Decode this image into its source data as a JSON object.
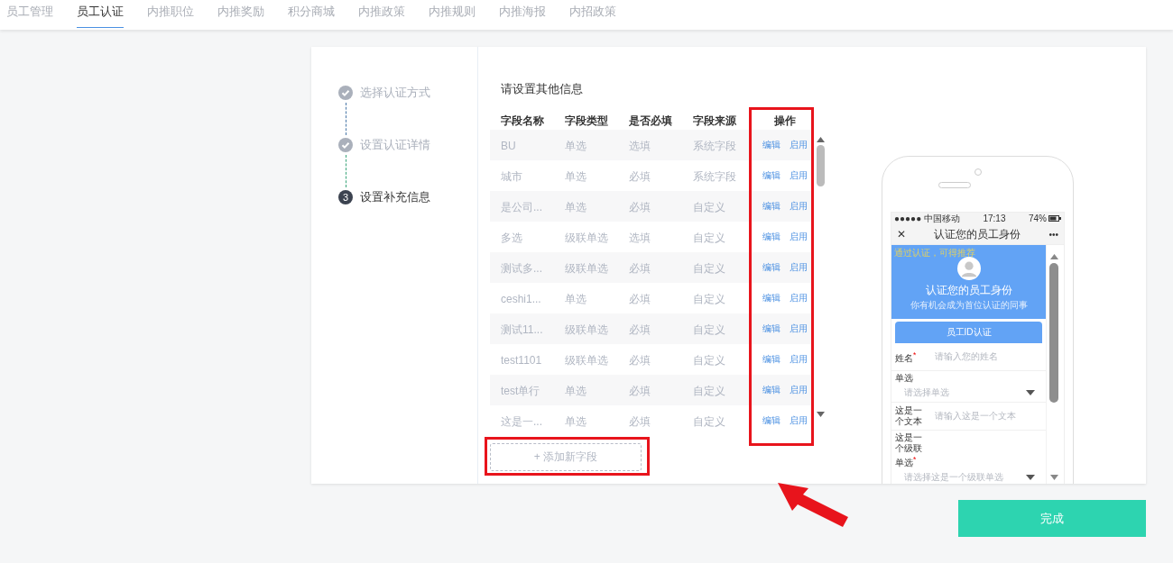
{
  "nav_tabs": [
    {
      "label": "员工管理",
      "selected": false
    },
    {
      "label": "员工认证",
      "selected": true
    },
    {
      "label": "内推职位",
      "selected": false
    },
    {
      "label": "内推奖励",
      "selected": false
    },
    {
      "label": "积分商城",
      "selected": false
    },
    {
      "label": "内推政策",
      "selected": false
    },
    {
      "label": "内推规则",
      "selected": false
    },
    {
      "label": "内推海报",
      "selected": false
    },
    {
      "label": "内招政策",
      "selected": false
    }
  ],
  "steps": [
    {
      "label": "选择认证方式",
      "kind": "done"
    },
    {
      "label": "设置认证详情",
      "kind": "done"
    },
    {
      "label": "设置补充信息",
      "kind": "current",
      "number": "3"
    }
  ],
  "section_title": "请设置其他信息",
  "table": {
    "columns": [
      "字段名称",
      "字段类型",
      "是否必填",
      "字段来源",
      "操作"
    ],
    "rows": [
      {
        "cells": [
          "BU",
          "单选",
          "选填",
          "系统字段"
        ],
        "actions": [
          "编辑",
          "启用"
        ]
      },
      {
        "cells": [
          "城市",
          "单选",
          "必填",
          "系统字段"
        ],
        "actions": [
          "编辑",
          "启用"
        ]
      },
      {
        "cells": [
          "是公司...",
          "单选",
          "必填",
          "自定义"
        ],
        "actions": [
          "编辑",
          "启用"
        ]
      },
      {
        "cells": [
          "多选",
          "级联单选",
          "选填",
          "自定义"
        ],
        "actions": [
          "编辑",
          "启用"
        ]
      },
      {
        "cells": [
          "测试多...",
          "级联单选",
          "必填",
          "自定义"
        ],
        "actions": [
          "编辑",
          "启用"
        ]
      },
      {
        "cells": [
          "ceshi1...",
          "单选",
          "必填",
          "自定义"
        ],
        "actions": [
          "编辑",
          "启用"
        ]
      },
      {
        "cells": [
          "测试11...",
          "级联单选",
          "必填",
          "自定义"
        ],
        "actions": [
          "编辑",
          "启用"
        ]
      },
      {
        "cells": [
          "test1101",
          "级联单选",
          "必填",
          "自定义"
        ],
        "actions": [
          "编辑",
          "启用"
        ]
      },
      {
        "cells": [
          "test单行",
          "单选",
          "必填",
          "自定义"
        ],
        "actions": [
          "编辑",
          "启用"
        ]
      },
      {
        "cells": [
          "这是一...",
          "单选",
          "必填",
          "自定义"
        ],
        "actions": [
          "编辑",
          "启用"
        ]
      }
    ]
  },
  "add_field_button": "+ 添加新字段",
  "phone_preview": {
    "status_bar": {
      "carrier": "●●●●● 中国移动",
      "time": "17:13",
      "battery": "74%"
    },
    "close": "✕",
    "title": "认证您的员工身份",
    "more": "•••",
    "banner_note": "通过认证，可得推荐",
    "banner_title": "认证您的员工身份",
    "banner_subtitle": "你有机会成为首位认证的同事",
    "id_button": "员工ID认证",
    "required_mark": "*",
    "form_fields": [
      {
        "label": "姓名",
        "required": true,
        "kind": "input",
        "placeholder": "请输入您的姓名"
      },
      {
        "label": "单选",
        "required": false,
        "kind": "select",
        "placeholder": "请选择单选"
      },
      {
        "label": "这是一个文本",
        "required": false,
        "kind": "input",
        "placeholder": "请输入这是一个文本"
      },
      {
        "label": "这是一个级联单选",
        "required": true,
        "kind": "select",
        "placeholder": "请选择这是一个级联单选"
      }
    ]
  },
  "finish_button": "完成"
}
